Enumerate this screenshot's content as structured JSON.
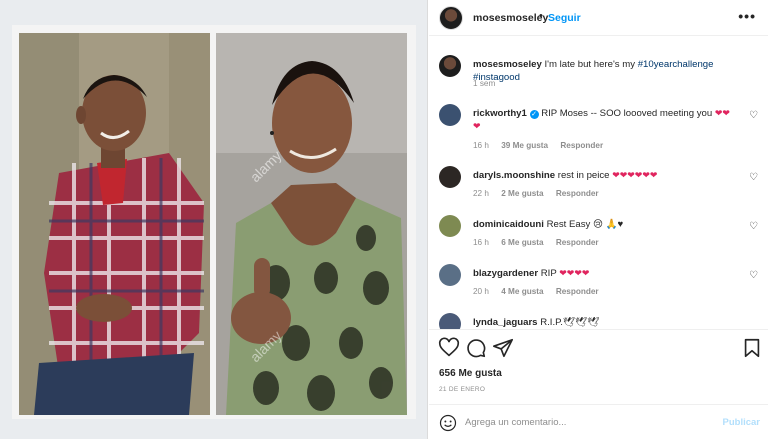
{
  "header": {
    "username": "mosesmoseley",
    "separator": "•",
    "follow_label": "Seguir",
    "more_icon": "more-horizontal-icon"
  },
  "caption": {
    "username": "mosesmoseley",
    "text": "I'm late but here's my",
    "hashtag1": "#10yearchallenge",
    "hashtag2": "#instagood",
    "time": "1 sem"
  },
  "comments": [
    {
      "username": "rickworthy1",
      "verified": true,
      "text": "RIP Moses -- SOO loooved meeting you",
      "hearts": "❤❤❤",
      "time": "16 h",
      "likes": "39 Me gusta",
      "reply": "Responder"
    },
    {
      "username": "daryls.moonshine",
      "verified": false,
      "text": "rest in peice",
      "hearts": "❤❤❤❤❤❤",
      "time": "22 h",
      "likes": "2 Me gusta",
      "reply": "Responder"
    },
    {
      "username": "dominicaidouni",
      "verified": false,
      "text": "Rest Easy 😢 🙏♥",
      "hearts": "",
      "time": "16 h",
      "likes": "6 Me gusta",
      "reply": "Responder"
    },
    {
      "username": "blazygardener",
      "verified": false,
      "text": "RIP",
      "hearts": "❤❤❤❤",
      "time": "20 h",
      "likes": "4 Me gusta",
      "reply": "Responder"
    },
    {
      "username": "lynda_jaguars",
      "verified": false,
      "text": "R.I.P.🕊🕊🕊",
      "hearts": "",
      "time": "",
      "likes": "",
      "reply": ""
    }
  ],
  "actions": {
    "likes_count": "656 Me gusta",
    "date": "21 DE ENERO"
  },
  "add_comment": {
    "placeholder": "Agrega un comentario...",
    "publish_label": "Publicar"
  },
  "watermarks": {
    "left": "alamy",
    "right": "alamy"
  },
  "colors": {
    "accent": "#0095f6",
    "heart": "#e0245e",
    "muted": "#8e8e8e"
  }
}
